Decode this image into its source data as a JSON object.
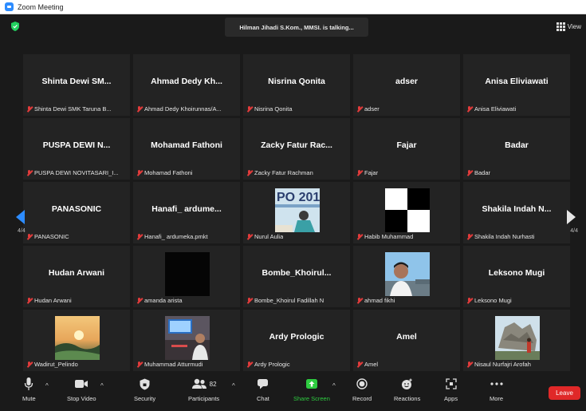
{
  "window": {
    "title": "Zoom Meeting"
  },
  "topbar": {
    "talking": "Hilman Jihadi S.Kom., MMSI. is talking...",
    "view_label": "View"
  },
  "pagination": {
    "left": "4/4",
    "right": "4/4"
  },
  "tiles": [
    {
      "display": "Shinta Dewi SM...",
      "label": "Shinta Dewi SMK Taruna B..."
    },
    {
      "display": "Ahmad Dedy Kh...",
      "label": "Ahmad Dedy Khoirunnas/A..."
    },
    {
      "display": "Nisrina Qonita",
      "label": "Nisrina Qonita"
    },
    {
      "display": "adser",
      "label": "adser"
    },
    {
      "display": "Anisa Eliviawati",
      "label": "Anisa Eliviawati"
    },
    {
      "display": "PUSPA DEWI N...",
      "label": "PUSPA DEWI NOVITASARI_I..."
    },
    {
      "display": "Mohamad Fathoni",
      "label": "Mohamad Fathoni"
    },
    {
      "display": "Zacky Fatur Rac...",
      "label": "Zacky Fatur Rachman"
    },
    {
      "display": "Fajar",
      "label": "Fajar"
    },
    {
      "display": "Badar",
      "label": "Badar"
    },
    {
      "display": "PANASONIC",
      "label": "PANASONIC"
    },
    {
      "display": "Hanafi_ ardume...",
      "label": "Hanafi_ ardumeka.pmkt"
    },
    {
      "display": "",
      "label": "Nurul Aulia",
      "video": "banner"
    },
    {
      "display": "",
      "label": "Habib Muhammad",
      "video": "checker"
    },
    {
      "display": "Shakila Indah N...",
      "label": "Shakila Indah Nurhasti"
    },
    {
      "display": "Hudan Arwani",
      "label": "Hudan Arwani"
    },
    {
      "display": "",
      "label": "amanda arista",
      "video": "black"
    },
    {
      "display": "Bombe_Khoirul...",
      "label": "Bombe_Khoirul Fadillah N"
    },
    {
      "display": "",
      "label": "ahmad fikhi",
      "video": "selfie"
    },
    {
      "display": "Leksono Mugi",
      "label": "Leksono Mugi"
    },
    {
      "display": "",
      "label": "Wadirut_Pelindo",
      "video": "sunset"
    },
    {
      "display": "",
      "label": "Muhammad Atturmudi",
      "video": "desk"
    },
    {
      "display": "Ardy Prologic",
      "label": "Ardy Prologic"
    },
    {
      "display": "Amel",
      "label": "Amel"
    },
    {
      "display": "",
      "label": "Nisaul Nurfajri Arofah",
      "video": "rocks"
    }
  ],
  "toolbar": {
    "mute": "Mute",
    "stop_video": "Stop Video",
    "security": "Security",
    "participants": "Participants",
    "participants_count": "82",
    "chat": "Chat",
    "share": "Share Screen",
    "record": "Record",
    "reactions": "Reactions",
    "apps": "Apps",
    "more": "More",
    "leave": "Leave"
  },
  "colors": {
    "accent": "#2d8cff",
    "share_green": "#2ecc40",
    "leave_red": "#e02828",
    "muted_red": "#e23b3b"
  }
}
